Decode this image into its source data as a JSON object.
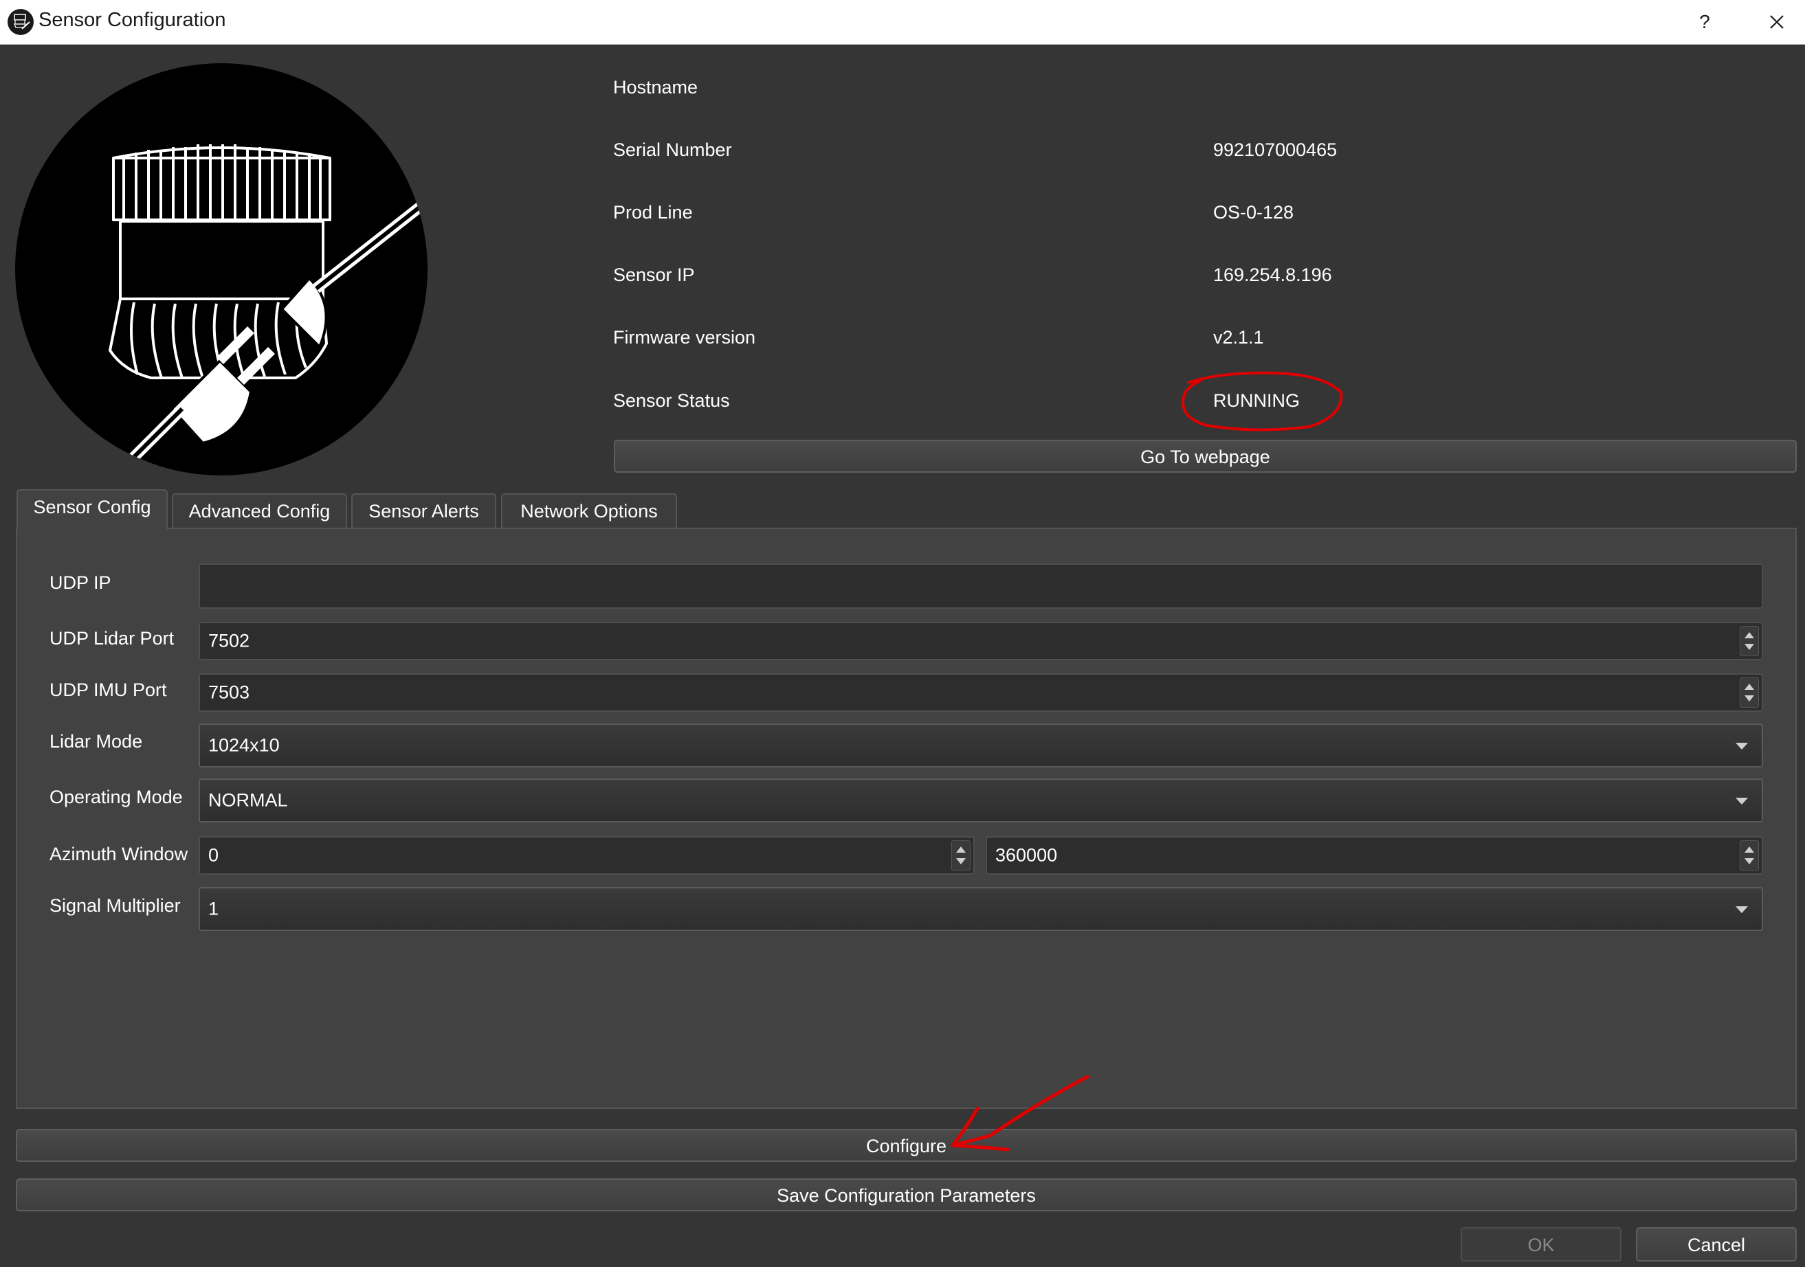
{
  "window": {
    "title": "Sensor Configuration",
    "help_label": "?",
    "close_icon": "close-icon"
  },
  "info": {
    "hostname": {
      "label": "Hostname",
      "value": ""
    },
    "serial_number": {
      "label": "Serial Number",
      "value": "992107000465"
    },
    "prod_line": {
      "label": "Prod Line",
      "value": "OS-0-128"
    },
    "sensor_ip": {
      "label": "Sensor IP",
      "value": "169.254.8.196"
    },
    "firmware": {
      "label": "Firmware version",
      "value": "v2.1.1"
    },
    "status": {
      "label": "Sensor Status",
      "value": "RUNNING"
    }
  },
  "webpage_button": "Go To webpage",
  "tabs": [
    {
      "label": "Sensor Config",
      "active": true
    },
    {
      "label": "Advanced Config",
      "active": false
    },
    {
      "label": "Sensor Alerts",
      "active": false
    },
    {
      "label": "Network Options",
      "active": false
    }
  ],
  "form": {
    "udp_ip": {
      "label": "UDP IP",
      "value": ""
    },
    "udp_lidar_port": {
      "label": "UDP Lidar Port",
      "value": "7502"
    },
    "udp_imu_port": {
      "label": "UDP IMU Port",
      "value": "7503"
    },
    "lidar_mode": {
      "label": "Lidar Mode",
      "value": "1024x10"
    },
    "operating_mode": {
      "label": "Operating Mode",
      "value": "NORMAL"
    },
    "azimuth_window": {
      "label": "Azimuth Window",
      "min": "0",
      "max": "360000"
    },
    "signal_multiplier": {
      "label": "Signal Multiplier",
      "value": "1"
    }
  },
  "buttons": {
    "configure": "Configure",
    "save": "Save Configuration Parameters",
    "ok": "OK",
    "cancel": "Cancel"
  },
  "colors": {
    "background": "#353535",
    "panel": "#424242",
    "annotation": "#e00000",
    "disabled_text": "#8a8a8a"
  }
}
